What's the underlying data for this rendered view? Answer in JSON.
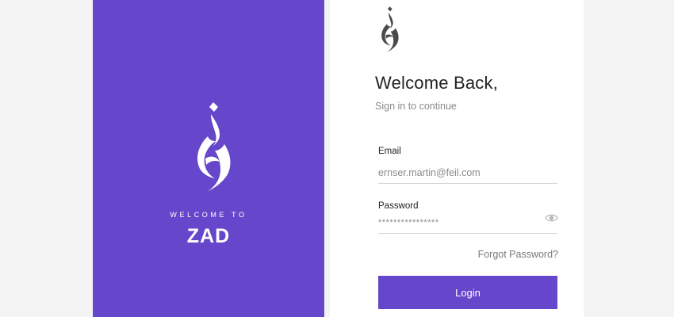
{
  "splash": {
    "welcome_text": "WELCOME TO",
    "brand_name": "ZAD",
    "logo_icon": "zad-calligraphy-logo-icon"
  },
  "login": {
    "logo_icon": "zad-calligraphy-logo-icon",
    "title": "Welcome Back,",
    "subtitle": "Sign in to continue",
    "email": {
      "label": "Email",
      "value": "ernser.martin@feil.com"
    },
    "password": {
      "label": "Password",
      "value": "****************",
      "toggle_icon": "eye-icon"
    },
    "forgot_label": "Forgot Password?",
    "login_label": "Login"
  },
  "colors": {
    "brand": "#6646cb",
    "background": "#f4f4f4",
    "card": "#ffffff",
    "logo_dark": "#4a4a4a"
  }
}
